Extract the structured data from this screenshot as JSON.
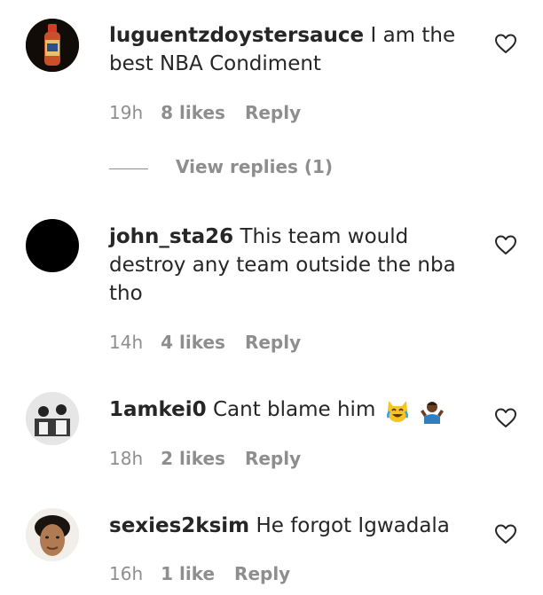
{
  "comments": [
    {
      "username": "luguentzdoystersauce",
      "text": "I am the best NBA Condiment",
      "time": "19h",
      "likes": "8 likes",
      "reply": "Reply",
      "view_replies": "View replies (1)"
    },
    {
      "username": "john_sta26",
      "text": "This team would destroy any team outside the nba tho",
      "time": "14h",
      "likes": "4 likes",
      "reply": "Reply"
    },
    {
      "username": "1amkei0",
      "text": "Cant blame him",
      "time": "18h",
      "likes": "2 likes",
      "reply": "Reply"
    },
    {
      "username": "sexies2ksim",
      "text": "He forgot Igwadala",
      "time": "16h",
      "likes": "1 like",
      "reply": "Reply"
    }
  ],
  "icons": {
    "like": "heart-outline-icon",
    "emoji_1": "cat-tears-of-joy-emoji",
    "emoji_2": "person-shrugging-emoji"
  },
  "colors": {
    "text": "#262626",
    "secondary": "#8e8e8e"
  }
}
